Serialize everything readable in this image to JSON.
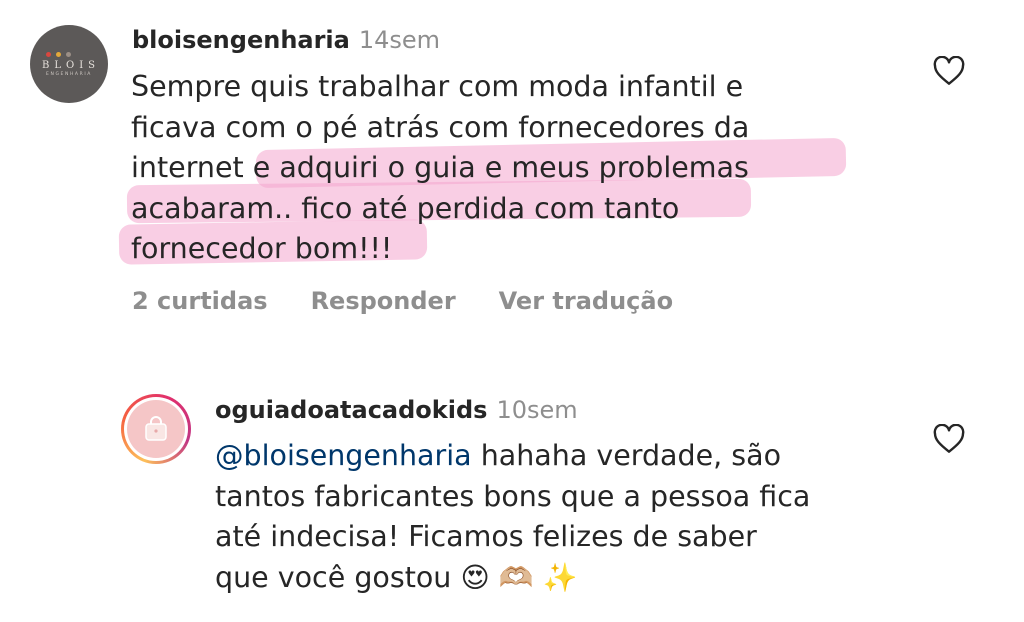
{
  "comments": [
    {
      "avatar": {
        "brand": "BLOIS",
        "subtitle": "ENGENHARIA",
        "dot_colors": [
          "#d9473f",
          "#e3a83a",
          "#9b8f86"
        ]
      },
      "username": "bloisengenharia",
      "time": "14sem",
      "lines": [
        "Sempre quis trabalhar com moda infantil e",
        "ficava com o pé atrás com fornecedores da",
        "internet e adquiri o guia e meus problemas",
        "acabaram.. fico até perdida com tanto",
        "fornecedor bom!!!"
      ],
      "highlight_color": "#f4a6cd",
      "actions": {
        "likes": "2 curtidas",
        "reply": "Responder",
        "translate": "Ver tradução"
      },
      "like_icon": "heart-outline-icon"
    },
    {
      "avatar": {
        "icon": "shopping-bag-icon",
        "ring": "story-gradient"
      },
      "username": "oguiadoatacadokids",
      "time": "10sem",
      "mention": "@bloisengenharia",
      "line1_rest": " hahaha verdade, são",
      "lines": [
        "tantos fabricantes bons que a pessoa fica",
        "até indecisa! Ficamos felizes de saber",
        "que você gostou"
      ],
      "emojis": [
        "😍",
        "🫶🏼",
        "✨"
      ],
      "like_icon": "heart-outline-icon"
    }
  ],
  "colors": {
    "text": "#262626",
    "secondary": "#8e8e8e",
    "mention": "#00376b",
    "background": "#ffffff"
  }
}
